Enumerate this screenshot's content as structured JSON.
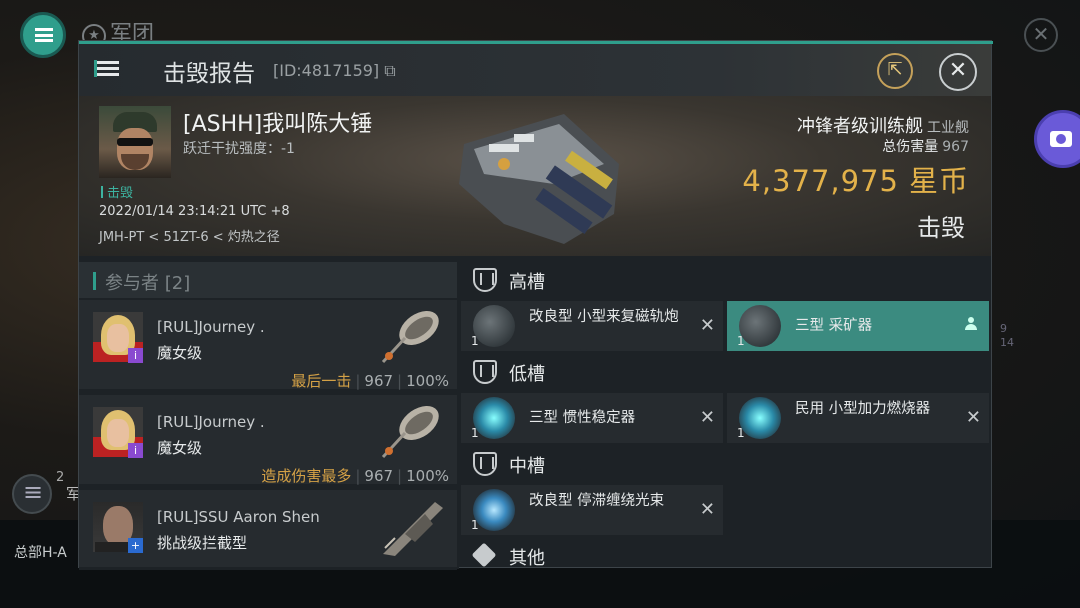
{
  "background": {
    "title": "军团",
    "hq_label": "总部H-A",
    "side_badge_count": "2",
    "side_label": "军",
    "right_numbers": [
      "9",
      "14"
    ]
  },
  "header": {
    "title": "击毁报告",
    "report_id": "[ID:4817159]"
  },
  "victim": {
    "name": "[ASHH]我叫陈大锤",
    "warp_disruption": "跃迁干扰强度：-1",
    "kill_tag": "击毁",
    "timestamp": "2022/01/14 23:14:21 UTC +8",
    "location": "JMH-PT < 51ZT-6 < 灼热之径",
    "ship_name": "冲锋者级训练舰",
    "ship_class": "工业舰",
    "total_damage_label": "总伤害量",
    "total_damage_value": "967",
    "isk_value": "4,377,975",
    "isk_unit": "星币",
    "status": "击毁"
  },
  "participants": {
    "header": "参与者 [2]",
    "rows": [
      {
        "name": "[RUL]Journey .",
        "ship": "魔女级",
        "stat_label": "最后一击",
        "damage": "967",
        "percent": "100%",
        "badge": "i"
      },
      {
        "name": "[RUL]Journey .",
        "ship": "魔女级",
        "stat_label": "造成伤害最多",
        "damage": "967",
        "percent": "100%",
        "badge": "i"
      },
      {
        "name": "[RUL]SSU Aaron Shen",
        "ship": "挑战级拦截型",
        "badge": "+"
      }
    ]
  },
  "fitting": {
    "high": {
      "label": "高槽",
      "modules": [
        {
          "name": "改良型 小型来复磁轨炮",
          "qty": "1",
          "status": "destroyed"
        },
        {
          "name": "三型 采矿器",
          "qty": "1",
          "status": "dropped"
        }
      ]
    },
    "low": {
      "label": "低槽",
      "modules": [
        {
          "name": "三型 惯性稳定器",
          "qty": "1",
          "status": "destroyed"
        },
        {
          "name": "民用 小型加力燃烧器",
          "qty": "1",
          "status": "destroyed"
        }
      ]
    },
    "mid": {
      "label": "中槽",
      "modules": [
        {
          "name": "改良型 停滞缠绕光束",
          "qty": "1",
          "status": "destroyed"
        }
      ]
    },
    "other": {
      "label": "其他"
    }
  },
  "icons": {
    "menu": "menu-icon",
    "share": "share-icon",
    "close": "close-icon",
    "camera": "camera-icon",
    "slot": "shield-icon",
    "other": "cube-icon"
  },
  "colors": {
    "accent": "#2f9e8c",
    "isk": "#e3b24a",
    "stat_label": "#d4a146",
    "badge_purple": "#8a4ad0",
    "badge_blue": "#2a6ad0"
  }
}
